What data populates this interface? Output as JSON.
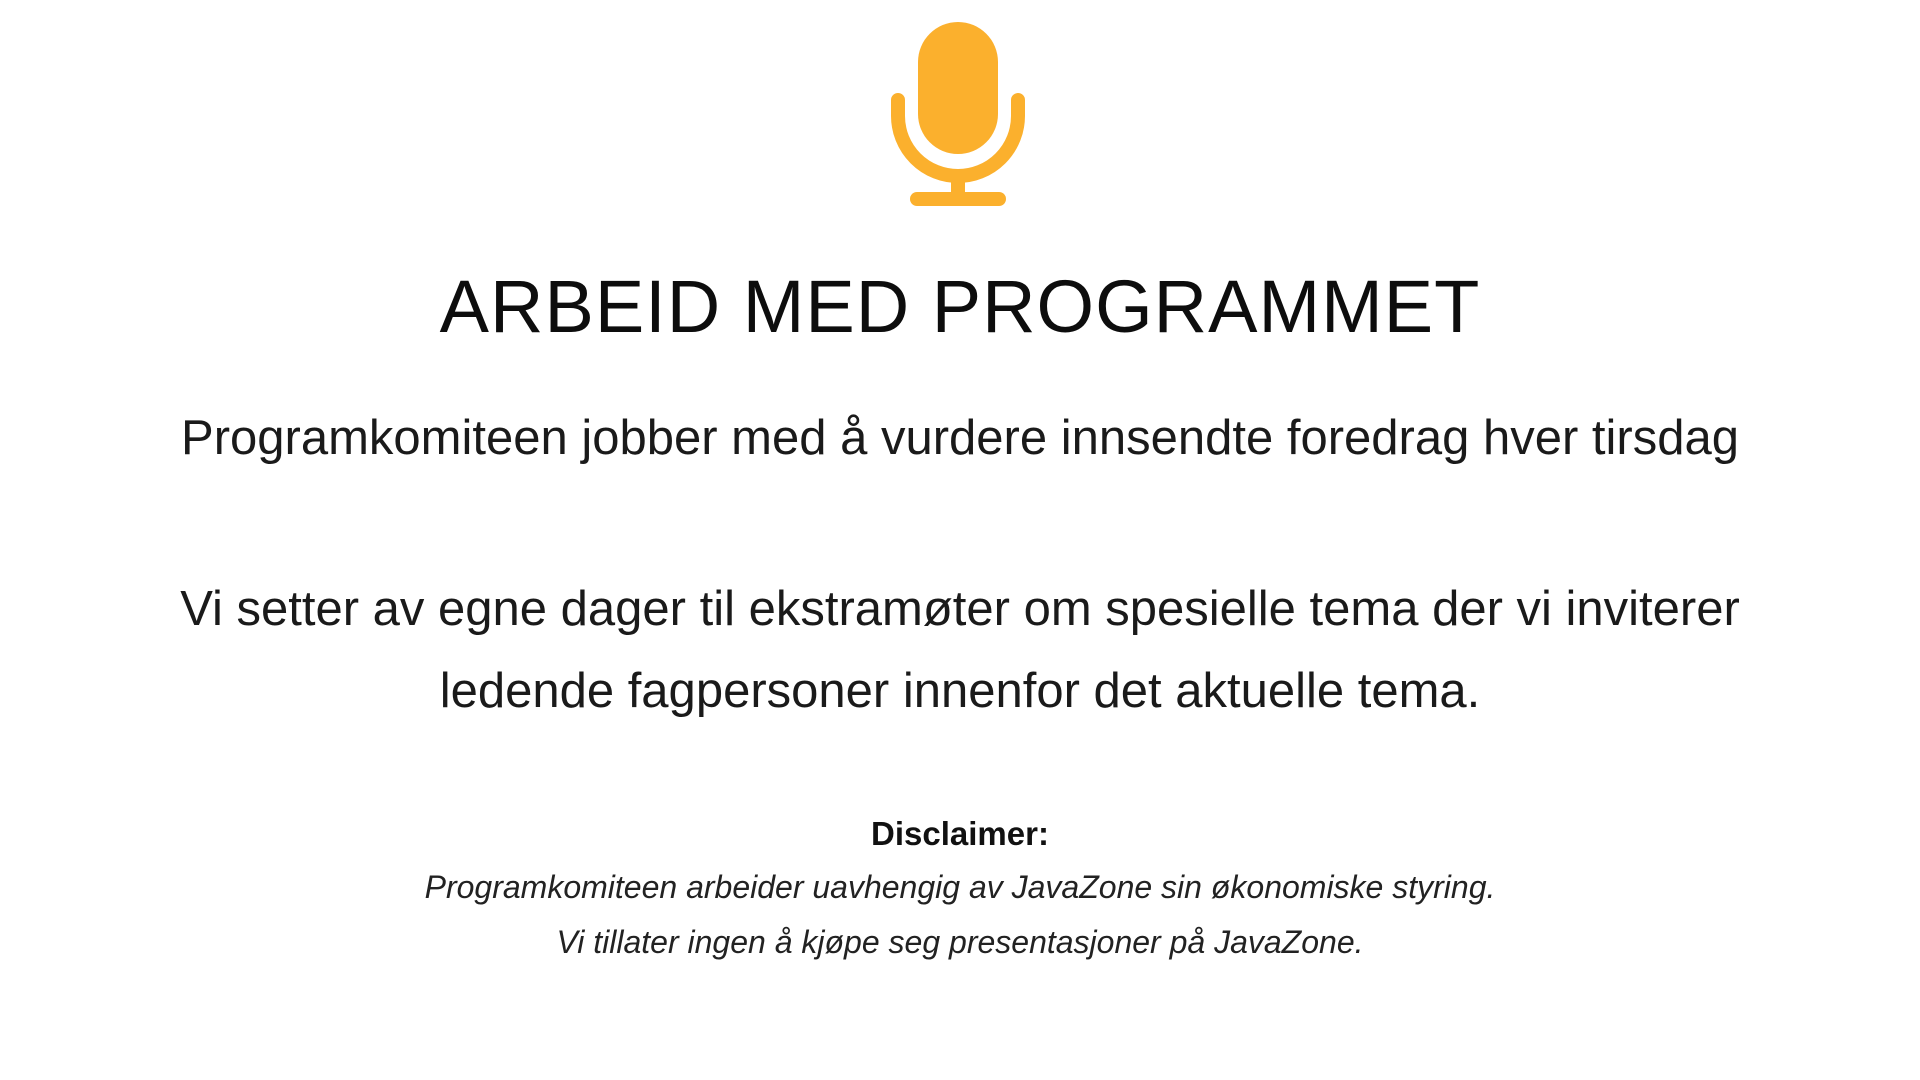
{
  "hero": {
    "icon": "microphone-icon",
    "accent_color": "#FBB02D"
  },
  "header": {
    "title": "ARBEID MED PROGRAMMET"
  },
  "main": {
    "paragraph_1": "Programkomiteen jobber med å vurdere innsendte foredrag hver tirsdag",
    "paragraph_2_lines": [
      "Vi setter av egne dager til ekstramøter om spesielle tema der vi inviterer",
      "ledende fagpersoner innenfor det aktuelle tema."
    ]
  },
  "disclaimer": {
    "title": "Disclaimer:",
    "lines": [
      "Programkomiteen arbeider uavhengig av JavaZone sin økonomiske styring.",
      "Vi tillater ingen å kjøpe seg presentasjoner på JavaZone."
    ]
  }
}
